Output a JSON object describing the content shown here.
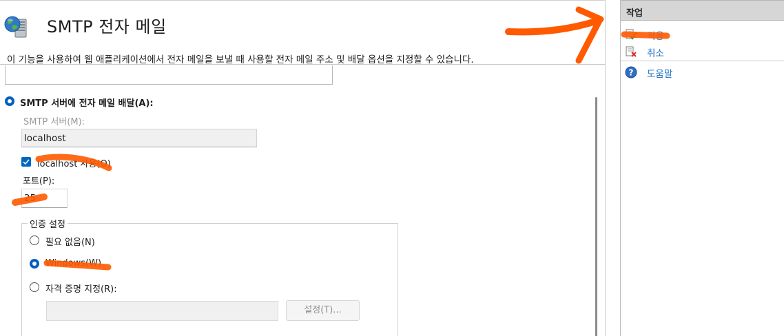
{
  "page": {
    "title": "SMTP 전자 메일",
    "description": "이 기능을 사용하여 웹 애플리케이션에서 전자 메일을 보낼 때 사용할 전자 메일 주소 및 배달 옵션을 지정할 수 있습니다."
  },
  "form": {
    "smtp_delivery_label": "SMTP 서버에 전자 메일 배달(A):",
    "smtp_server_label": "SMTP 서버(M):",
    "smtp_server_value": "localhost",
    "use_localhost_label": "localhost 사용(O)",
    "use_localhost_checked": true,
    "port_label": "포트(P):",
    "port_value": "25",
    "auth": {
      "legend": "인증 설정",
      "none_label": "필요 없음(N)",
      "windows_label": "Windows(W)",
      "credentials_label": "자격 증명 지정(R):",
      "selected": "Windows(W)",
      "settings_button": "설정(T)..."
    }
  },
  "actions": {
    "title": "작업",
    "items": [
      {
        "label": "적용",
        "icon": "apply-icon"
      },
      {
        "label": "취소",
        "icon": "cancel-icon"
      },
      {
        "label": "도움말",
        "icon": "help-icon"
      }
    ]
  },
  "colors": {
    "accent": "#0067c0",
    "link": "#1a6fc2",
    "annotation": "#ff5a00",
    "actions_header": "#d6d6d6"
  }
}
